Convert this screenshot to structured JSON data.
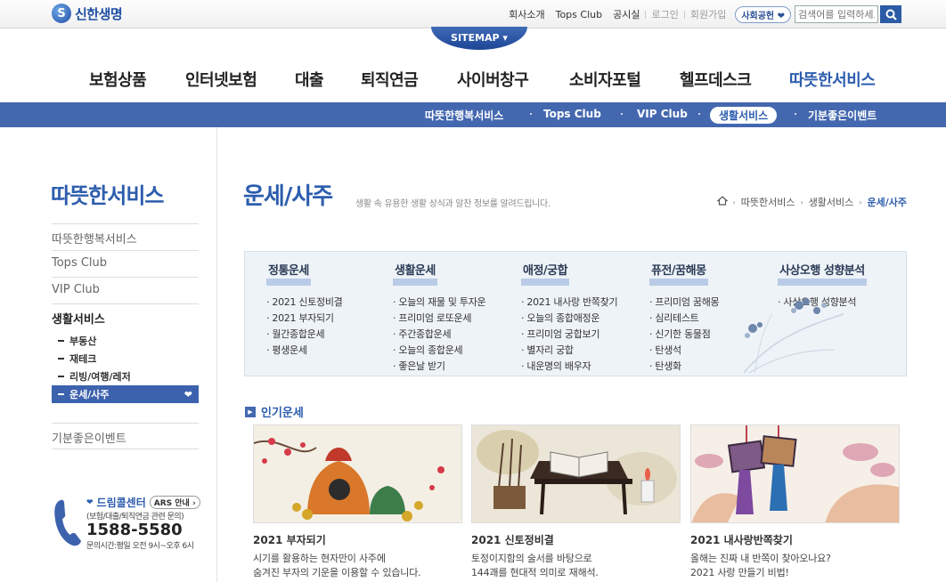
{
  "top": {
    "logo_mark": "S",
    "logo_text": "신한생명",
    "links": [
      "회사소개",
      "Tops Club",
      "공시실"
    ],
    "login": "로그인",
    "join": "회원가입",
    "social_button": "사회공헌",
    "search_placeholder": "검색어를 입력하세요"
  },
  "sitemap": "SITEMAP ▾",
  "gnb": {
    "items": [
      {
        "label": "보험상품"
      },
      {
        "label": "인터넷보험"
      },
      {
        "label": "대출"
      },
      {
        "label": "퇴직연금"
      },
      {
        "label": "사이버창구"
      },
      {
        "label": "소비자포털"
      },
      {
        "label": "헬프데스크"
      },
      {
        "label": "따뜻한서비스"
      }
    ]
  },
  "subnav": {
    "items": [
      "따뜻한행복서비스",
      "Tops Club",
      "VIP Club",
      "생활서비스",
      "기분좋은이벤트"
    ]
  },
  "lnb": {
    "title": "따뜻한서비스",
    "main": [
      "따뜻한행복서비스",
      "Tops Club",
      "VIP Club",
      "생활서비스"
    ],
    "sub": [
      "부동산",
      "재테크",
      "리빙/여행/레저",
      "운세/사주"
    ],
    "last": "기분좋은이벤트"
  },
  "call": {
    "title": "드림콜센터",
    "ars": "ARS 안내",
    "desc": "(보험/대출/퇴직연금 관련 문의)",
    "number": "1588-5580",
    "hours": "문의시간:평일 오전 9시~오후 6시"
  },
  "page": {
    "title": "운세/사주",
    "desc": "생활 속 유용한 생활 상식과 알찬 정보를 알려드립니다.",
    "breadcrumb": [
      "따뜻한서비스",
      "생활서비스",
      "운세/사주"
    ]
  },
  "menu": [
    {
      "title": "정통운세",
      "items": [
        "2021 신토정비결",
        "2021 부자되기",
        "월간종합운세",
        "평생운세"
      ]
    },
    {
      "title": "생활운세",
      "items": [
        "오늘의 재물 및 투자운",
        "프리미엄 로또운세",
        "주간종합운세",
        "오늘의 종합운세",
        "좋은날 받기"
      ]
    },
    {
      "title": "애정/궁합",
      "items": [
        "2021 내사랑 반쪽찾기",
        "오늘의 종합애정운",
        "프리미엄 궁합보기",
        "별자리 궁합",
        "내운명의 배우자"
      ]
    },
    {
      "title": "퓨전/꿈해몽",
      "items": [
        "프리미엄 꿈해몽",
        "심리테스트",
        "신기한 동물점",
        "탄생석",
        "탄생화"
      ]
    },
    {
      "title": "사상오행 성향분석",
      "items": [
        "사상오행 성향분석"
      ]
    }
  ],
  "popular": {
    "title": "인기운세",
    "cards": [
      {
        "title": "2021 부자되기",
        "desc1": "시기를 활용하는 현자만이 사주에",
        "desc2": "숨겨진 부자의 기운을 이용할 수 있습니다."
      },
      {
        "title": "2021 신토정비결",
        "desc1": "토정이지함의 술서를 바탕으로",
        "desc2": "144괘를 현대적 의미로 재해석."
      },
      {
        "title": "2021 내사랑반쪽찾기",
        "desc1": "올해는 진짜 내 반쪽이 찾아오나요?",
        "desc2": "2021 사랑 만들기 비법!"
      }
    ]
  }
}
